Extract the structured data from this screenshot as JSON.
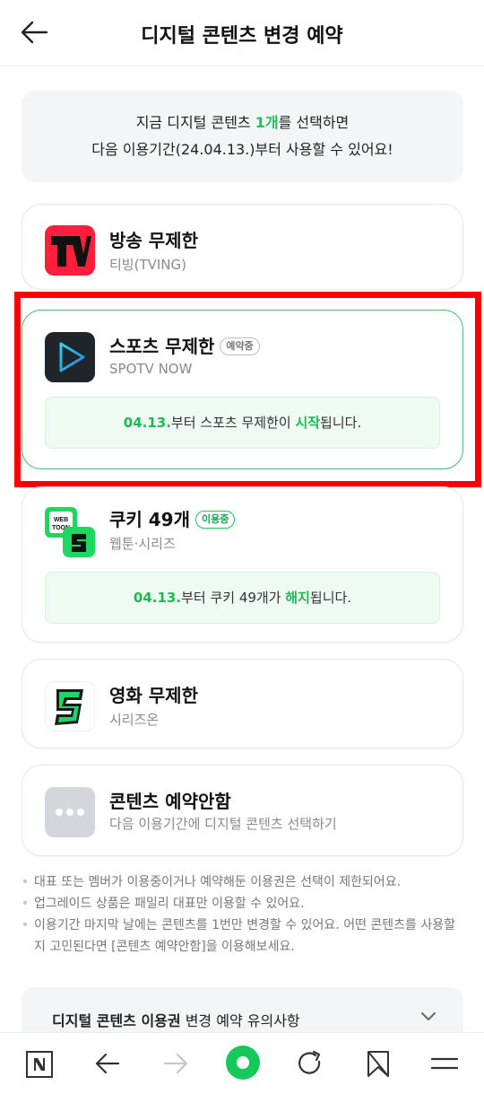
{
  "header": {
    "title": "디지털 콘텐츠 변경 예약"
  },
  "info": {
    "line1_pre": "지금 디지털 콘텐츠 ",
    "line1_count": "1개",
    "line1_post": "를 선택하면",
    "line2": "다음 이용기간(24.04.13.)부터 사용할 수 있어요!"
  },
  "cards": [
    {
      "title": "방송 무제한",
      "subtitle": "티빙(TVING)",
      "logo": "tving-logo"
    },
    {
      "title": "스포츠 무제한",
      "badge": "예약중",
      "subtitle": "SPOTV NOW",
      "logo": "spotv-logo",
      "notice_date": "04.13.",
      "notice_mid": "부터 스포츠 무제한이 ",
      "notice_action": "시작",
      "notice_end": "됩니다."
    },
    {
      "title": "쿠키 49개",
      "badge": "이용중",
      "subtitle": "웹툰·시리즈",
      "logo": "webtoon-logo",
      "logo_text": "WEB TOON",
      "notice_date": "04.13.",
      "notice_mid": "부터 쿠키 49개가 ",
      "notice_action": "해지",
      "notice_end": "됩니다."
    },
    {
      "title": "영화 무제한",
      "subtitle": "시리즈온",
      "logo": "serieson-logo"
    },
    {
      "title": "콘텐츠 예약안함",
      "subtitle": "다음 이용기간에 디지털 콘텐츠 선택하기",
      "logo": "more-dots-icon"
    }
  ],
  "notes": [
    "대표 또는 멤버가 이용중이거나 예약해둔 이용권은 선택이 제한되어요.",
    "업그레이드 상품은 패밀리 대표만 이용할 수 있어요.",
    "이용기간 마지막 날에는 콘텐츠를 1번만 변경할 수 있어요. 어떤 콘텐츠를 사용할지 고민된다면 [콘텐츠 예약안함]을 이용해보세요."
  ],
  "caution": {
    "title_bold": "디지털 콘텐츠 이용권",
    "title_rest": " 변경 예약 유의사항"
  },
  "colors": {
    "accent_green": "#1db954",
    "selected_border": "#3fbf75",
    "highlight_red": "#ff0000"
  }
}
